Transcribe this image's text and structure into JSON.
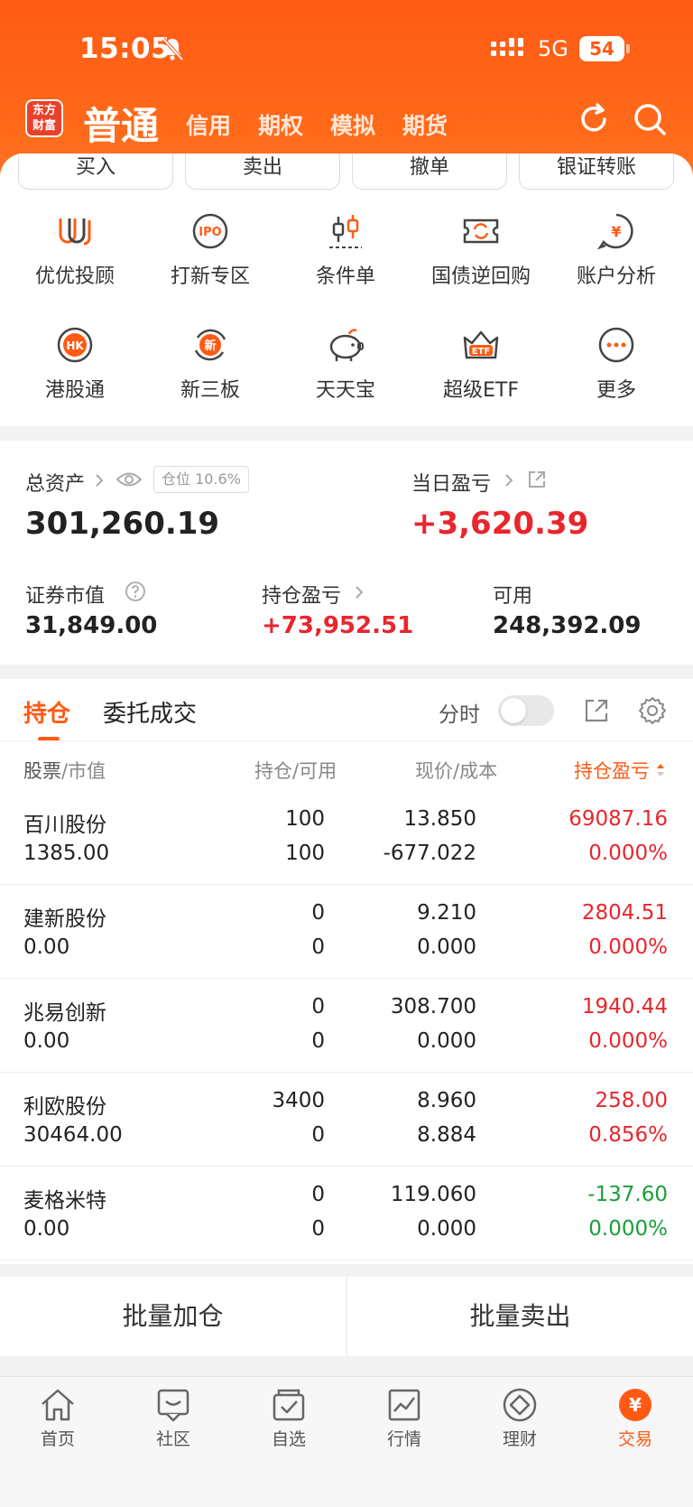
{
  "status": {
    "time": "15:05",
    "network": "5G",
    "battery": "54"
  },
  "header": {
    "logo_line1": "东方",
    "logo_line2": "财富",
    "main_tab": "普通",
    "tabs": [
      "信用",
      "期权",
      "模拟",
      "期货"
    ]
  },
  "actions_top": [
    "买入",
    "卖出",
    "撤单",
    "银证转账"
  ],
  "grid": [
    {
      "label": "优优投顾",
      "icon": "uu-advisor-icon"
    },
    {
      "label": "打新专区",
      "icon": "ipo-icon",
      "icon_text": "IPO"
    },
    {
      "label": "条件单",
      "icon": "candlestick-icon"
    },
    {
      "label": "国债逆回购",
      "icon": "repo-ticket-icon"
    },
    {
      "label": "账户分析",
      "icon": "account-analysis-icon",
      "icon_text": "¥"
    },
    {
      "label": "港股通",
      "icon": "hk-icon",
      "icon_text": "HK"
    },
    {
      "label": "新三板",
      "icon": "new-third-board-icon",
      "icon_text": "新"
    },
    {
      "label": "天天宝",
      "icon": "piggy-bank-icon"
    },
    {
      "label": "超级ETF",
      "icon": "etf-crown-icon",
      "icon_text": "ETF"
    },
    {
      "label": "更多",
      "icon": "more-dots-icon"
    }
  ],
  "assets": {
    "total_label": "总资产",
    "total_value": "301,260.19",
    "position_ratio": "仓位 10.6%",
    "daily_pnl_label": "当日盈亏",
    "daily_pnl_value": "+3,620.39",
    "market_value_label": "证券市值",
    "market_value": "31,849.00",
    "holding_pnl_label": "持仓盈亏",
    "holding_pnl_value": "+73,952.51",
    "available_label": "可用",
    "available_value": "248,392.09"
  },
  "positions": {
    "tabs": [
      "持仓",
      "委托成交"
    ],
    "toggle_label": "分时",
    "headers": {
      "stock": "股票",
      "stock_sub": "/市值",
      "hold": "持仓",
      "hold_sub": "/可用",
      "price": "现价",
      "price_sub": "/成本",
      "pnl": "持仓盈亏"
    },
    "rows": [
      {
        "name": "百川股份",
        "market_value": "1385.00",
        "hold": "100",
        "available": "100",
        "price": "13.850",
        "cost": "-677.022",
        "pnl": "69087.16",
        "pnl_pct": "0.000%",
        "tone": "red"
      },
      {
        "name": "建新股份",
        "market_value": "0.00",
        "hold": "0",
        "available": "0",
        "price": "9.210",
        "cost": "0.000",
        "pnl": "2804.51",
        "pnl_pct": "0.000%",
        "tone": "red"
      },
      {
        "name": "兆易创新",
        "market_value": "0.00",
        "hold": "0",
        "available": "0",
        "price": "308.700",
        "cost": "0.000",
        "pnl": "1940.44",
        "pnl_pct": "0.000%",
        "tone": "red"
      },
      {
        "name": "利欧股份",
        "market_value": "30464.00",
        "hold": "3400",
        "available": "0",
        "price": "8.960",
        "cost": "8.884",
        "pnl": "258.00",
        "pnl_pct": "0.856%",
        "tone": "red"
      },
      {
        "name": "麦格米特",
        "market_value": "0.00",
        "hold": "0",
        "available": "0",
        "price": "119.060",
        "cost": "0.000",
        "pnl": "-137.60",
        "pnl_pct": "0.000%",
        "tone": "green"
      }
    ]
  },
  "bulk": {
    "add": "批量加仓",
    "sell": "批量卖出"
  },
  "tabbar": [
    {
      "label": "首页",
      "icon": "home-icon"
    },
    {
      "label": "社区",
      "icon": "community-icon"
    },
    {
      "label": "自选",
      "icon": "watchlist-icon"
    },
    {
      "label": "行情",
      "icon": "market-chart-icon"
    },
    {
      "label": "理财",
      "icon": "wealth-diamond-icon"
    },
    {
      "label": "交易",
      "icon": "trade-yuan-icon",
      "icon_text": "¥",
      "active": true
    }
  ],
  "colors": {
    "brand": "#ff5a14",
    "up": "#e8262d",
    "down": "#1a9e3a"
  }
}
